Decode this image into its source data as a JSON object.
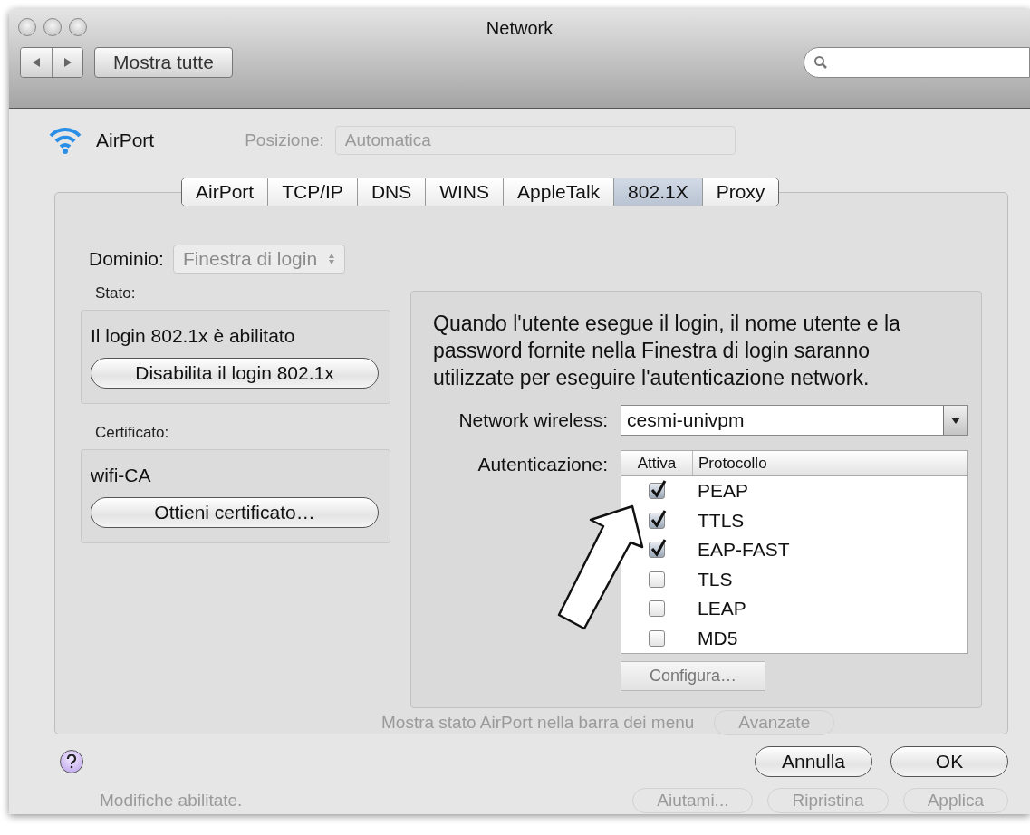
{
  "window": {
    "title": "Network"
  },
  "toolbar": {
    "show_all_button": "Mostra tutte"
  },
  "service": {
    "name": "AirPort"
  },
  "background": {
    "location_label": "Posizione:",
    "location_value": "Automatica",
    "menu_bar_option": "Mostra stato AirPort nella barra dei menu",
    "advanced_button": "Avanzate",
    "lock_status": "Modifiche abilitate.",
    "buttons": [
      "Aiutami...",
      "Ripristina",
      "Applica"
    ]
  },
  "tabs": [
    {
      "label": "AirPort",
      "selected": false
    },
    {
      "label": "TCP/IP",
      "selected": false
    },
    {
      "label": "DNS",
      "selected": false
    },
    {
      "label": "WINS",
      "selected": false
    },
    {
      "label": "AppleTalk",
      "selected": false
    },
    {
      "label": "802.1X",
      "selected": true
    },
    {
      "label": "Proxy",
      "selected": false
    }
  ],
  "domain": {
    "label": "Dominio:",
    "value": "Finestra di login"
  },
  "status": {
    "label": "Stato:",
    "text": "Il login 802.1x è abilitato",
    "button": "Disabilita il login 802.1x"
  },
  "certificate": {
    "label": "Certificato:",
    "name": "wifi-CA",
    "button": "Ottieni certificato…"
  },
  "description": "Quando l'utente esegue il login, il nome utente e la password fornite nella Finestra di login saranno utilizzate per eseguire l'autenticazione network.",
  "wireless_network": {
    "label": "Network wireless:",
    "value": "cesmi-univpm"
  },
  "authentication": {
    "label": "Autenticazione:",
    "columns": [
      "Attiva",
      "Protocollo"
    ],
    "rows": [
      {
        "protocol": "PEAP",
        "checked": true
      },
      {
        "protocol": "TTLS",
        "checked": true
      },
      {
        "protocol": "EAP-FAST",
        "checked": true
      },
      {
        "protocol": "TLS",
        "checked": false
      },
      {
        "protocol": "LEAP",
        "checked": false
      },
      {
        "protocol": "MD5",
        "checked": false
      }
    ],
    "configure_button": {
      "label": "Configura…",
      "disabled": true
    }
  },
  "dialog_buttons": [
    "Annulla",
    "OK"
  ]
}
